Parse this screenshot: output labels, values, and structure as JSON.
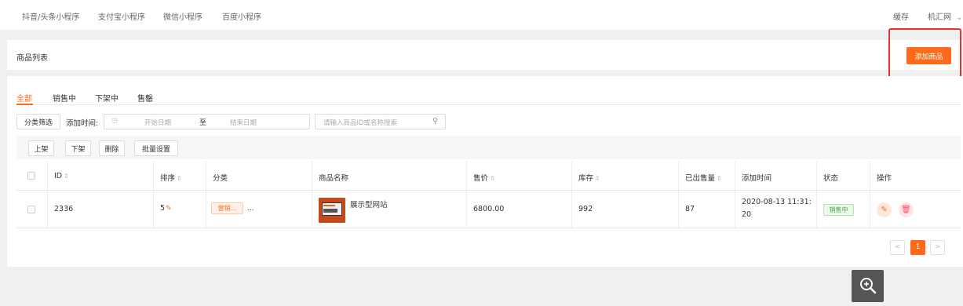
{
  "top_nav": {
    "tabs": [
      "抖音/头条小程序",
      "支付宝小程序",
      "微信小程序",
      "百度小程序"
    ],
    "cache_label": "缓存",
    "user_label": "机汇网"
  },
  "header": {
    "title": "商品列表",
    "add_button_label": "添加商品"
  },
  "status_tabs": [
    "全部",
    "销售中",
    "下架中",
    "售罄"
  ],
  "filters": {
    "category_button": "分类筛选",
    "date_label": "添加时间:",
    "start_placeholder": "开始日期",
    "range_separator": "至",
    "end_placeholder": "结束日期",
    "search_placeholder": "请输入商品ID或名称搜索"
  },
  "bulk_actions": [
    "上架",
    "下架",
    "删除",
    "批量设置"
  ],
  "table": {
    "columns": [
      "ID",
      "排序",
      "分类",
      "商品名称",
      "售价",
      "库存",
      "已出售量",
      "添加时间",
      "状态",
      "操作"
    ],
    "rows": [
      {
        "id": "2336",
        "sort": "5",
        "category": "营销...",
        "category_more": "...",
        "name": "展示型网站",
        "price": "6800.00",
        "stock": "992",
        "sold": "87",
        "added_time_line1": "2020-08-13 11:31:",
        "added_time_line2": "20",
        "status": "销售中"
      }
    ]
  },
  "pagination": {
    "current_page": "1",
    "prev": "<",
    "next": ">"
  },
  "colors": {
    "accent": "#ff6a1a",
    "highlight_border": "#e8322e",
    "status_green": "#3fa33f"
  }
}
